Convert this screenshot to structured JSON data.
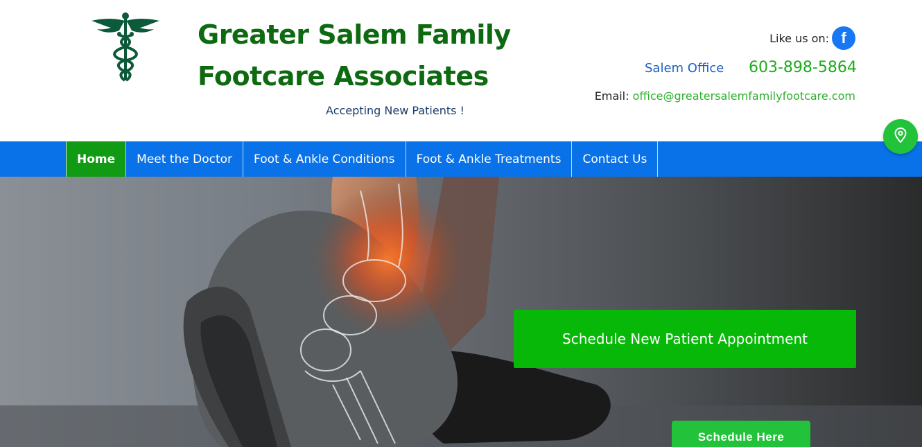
{
  "header": {
    "site_title_line1": "Greater Salem Family",
    "site_title_line2": "Footcare Associates",
    "tagline": "Accepting New Patients !",
    "logo_icon": "caduceus-icon",
    "like_label": "Like us on:",
    "facebook_glyph": "f",
    "office_label": "Salem Office",
    "office_phone": "603-898-5864",
    "email_label": "Email:",
    "email_address": "office@greatersalemfamilyfootcare.com"
  },
  "nav": {
    "items": [
      {
        "label": "Home",
        "active": true
      },
      {
        "label": "Meet the Doctor",
        "active": false
      },
      {
        "label": "Foot & Ankle Conditions",
        "active": false
      },
      {
        "label": "Foot & Ankle Treatments",
        "active": false
      },
      {
        "label": "Contact Us",
        "active": false
      }
    ]
  },
  "hero": {
    "cta_primary": "Schedule New Patient Appointment",
    "cta_secondary": "Schedule Here"
  },
  "floating": {
    "map_icon": "map-pin-icon"
  },
  "colors": {
    "brand_green": "#0d6a10",
    "nav_blue": "#0a72e8",
    "active_green": "#119a14",
    "cta_green": "#08b808",
    "facebook_blue": "#1877f2"
  }
}
